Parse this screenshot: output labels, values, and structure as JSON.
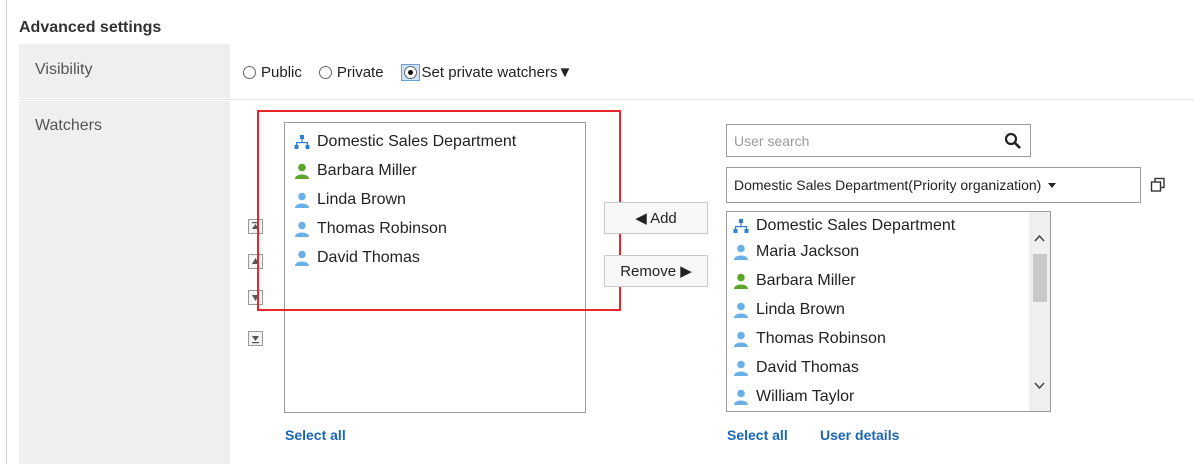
{
  "section_title": "Advanced settings",
  "visibility": {
    "label": "Visibility",
    "options": [
      "Public",
      "Private",
      "Set private watchers▼"
    ],
    "selected": "Set private watchers▼"
  },
  "watchers": {
    "label": "Watchers",
    "selected_list": [
      {
        "name": "Domestic Sales Department",
        "icon": "org-icon"
      },
      {
        "name": "Barbara Miller",
        "icon": "user-green-icon"
      },
      {
        "name": "Linda Brown",
        "icon": "user-icon"
      },
      {
        "name": "Thomas Robinson",
        "icon": "user-icon"
      },
      {
        "name": "David Thomas",
        "icon": "user-icon"
      }
    ],
    "select_all": "Select all",
    "add_label": "◀ Add",
    "remove_label": "Remove ▶",
    "search_placeholder": "User search",
    "org_select": "Domestic Sales Department(Priority organization)",
    "candidates": [
      {
        "name": "Domestic Sales Department",
        "icon": "org-icon"
      },
      {
        "name": "Maria Jackson",
        "icon": "user-icon"
      },
      {
        "name": "Barbara Miller",
        "icon": "user-green-icon"
      },
      {
        "name": "Linda Brown",
        "icon": "user-icon"
      },
      {
        "name": "Thomas Robinson",
        "icon": "user-icon"
      },
      {
        "name": "David Thomas",
        "icon": "user-icon"
      },
      {
        "name": "William Taylor",
        "icon": "user-icon"
      }
    ],
    "candidates_select_all": "Select all",
    "user_details": "User details"
  },
  "colors": {
    "accent_link": "#1a66b3",
    "highlight": "#e8262a",
    "user_icon": "#6ab0e8",
    "user_green_icon": "#5aa628",
    "org_icon": "#2f7fd0"
  }
}
